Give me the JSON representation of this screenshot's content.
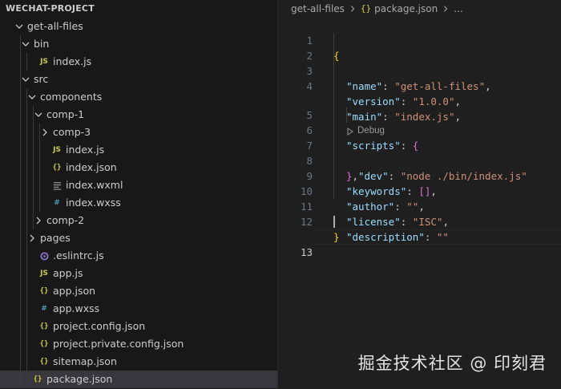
{
  "explorer": {
    "title": "WECHAT-PROJECT",
    "items": [
      {
        "label": "get-all-files",
        "kind": "folder-open",
        "depth": 0
      },
      {
        "label": "bin",
        "kind": "folder-open",
        "depth": 1
      },
      {
        "label": "index.js",
        "kind": "js",
        "depth": 2
      },
      {
        "label": "src",
        "kind": "folder-open",
        "depth": 1
      },
      {
        "label": "components",
        "kind": "folder-open",
        "depth": 2
      },
      {
        "label": "comp-1",
        "kind": "folder-open",
        "depth": 3
      },
      {
        "label": "comp-3",
        "kind": "folder-closed",
        "depth": 4
      },
      {
        "label": "index.js",
        "kind": "js",
        "depth": 4
      },
      {
        "label": "index.json",
        "kind": "json",
        "depth": 4
      },
      {
        "label": "index.wxml",
        "kind": "wxml",
        "depth": 4
      },
      {
        "label": "index.wxss",
        "kind": "wxss",
        "depth": 4
      },
      {
        "label": "comp-2",
        "kind": "folder-closed",
        "depth": 3
      },
      {
        "label": "pages",
        "kind": "folder-closed",
        "depth": 2
      },
      {
        "label": ".eslintrc.js",
        "kind": "eslint",
        "depth": 2
      },
      {
        "label": "app.js",
        "kind": "js",
        "depth": 2
      },
      {
        "label": "app.json",
        "kind": "json",
        "depth": 2
      },
      {
        "label": "app.wxss",
        "kind": "wxss",
        "depth": 2
      },
      {
        "label": "project.config.json",
        "kind": "json",
        "depth": 2
      },
      {
        "label": "project.private.config.json",
        "kind": "json",
        "depth": 2
      },
      {
        "label": "sitemap.json",
        "kind": "json",
        "depth": 2
      },
      {
        "label": "package.json",
        "kind": "json",
        "depth": 1,
        "selected": true
      }
    ],
    "icon_glyphs": {
      "js": "JS",
      "json": "{}",
      "wxss": "#"
    }
  },
  "editor": {
    "breadcrumb": {
      "folder": "get-all-files",
      "file_icon": "{}",
      "file": "package.json",
      "more": "..."
    },
    "codelens": "Debug",
    "line_numbers": [
      "1",
      "2",
      "3",
      "4",
      "5",
      "6",
      "7",
      "8",
      "9",
      "10",
      "11",
      "12",
      "13"
    ],
    "code": {
      "l1": "{",
      "l2_key": "\"name\"",
      "l2_val": "\"get-all-files\"",
      "l3_key": "\"version\"",
      "l3_val": "\"1.0.0\"",
      "l4_key": "\"main\"",
      "l4_val": "\"index.js\"",
      "l5_key": "\"scripts\"",
      "l5_open": "{",
      "l6_key": "\"dev\"",
      "l6_val": "\"node ./bin/index.js\"",
      "l7_close": "}",
      "l8_key": "\"keywords\"",
      "l8_val": "[]",
      "l9_key": "\"author\"",
      "l9_val": "\"\"",
      "l10_key": "\"license\"",
      "l10_val": "\"ISC\"",
      "l11_key": "\"description\"",
      "l11_val": "\"\"",
      "l12": "}"
    }
  },
  "watermark": "掘金技术社区 @ 印刻君",
  "colors": {
    "json_key": "#9cdcfe",
    "json_string": "#ce9178",
    "bracket_level1": "#ffd700",
    "bracket_level2": "#da70d6",
    "js_icon": "#cbcb41",
    "wxss_icon": "#519aba",
    "eslint_icon": "#8a72c9",
    "selection": "#37373d"
  }
}
